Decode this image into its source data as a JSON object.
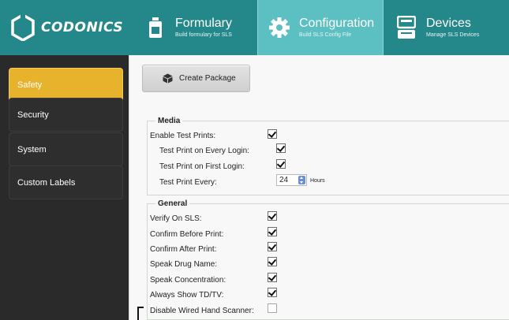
{
  "brand": {
    "name": "CODONICS"
  },
  "nav": {
    "tabs": [
      {
        "title": "Formulary",
        "subtitle": "Build formulary for SLS",
        "icon": "bottle-icon",
        "active": false
      },
      {
        "title": "Configuration",
        "subtitle": "Build SLS Config File",
        "icon": "gear-icon",
        "active": true
      },
      {
        "title": "Devices",
        "subtitle": "Manage SLS Devices",
        "icon": "printer-device-icon",
        "active": false
      }
    ]
  },
  "sidebar": {
    "items": [
      {
        "label": "Safety",
        "active": true
      },
      {
        "label": "Security",
        "active": false
      },
      {
        "label": "System",
        "active": false
      },
      {
        "label": "Custom Labels",
        "active": false
      }
    ]
  },
  "toolbar": {
    "create_package_label": "Create Package"
  },
  "media": {
    "legend": "Media",
    "enable_test_prints": {
      "label": "Enable Test Prints:",
      "checked": true
    },
    "test_print_every_login": {
      "label": "Test Print on Every Login:",
      "checked": true
    },
    "test_print_first_login": {
      "label": "Test Print on First Login:",
      "checked": true
    },
    "test_print_every": {
      "label": "Test Print Every:",
      "value": "24",
      "unit": "Hours"
    }
  },
  "general": {
    "legend": "General",
    "items": [
      {
        "label": "Verify On SLS:",
        "checked": true
      },
      {
        "label": "Confirm Before Print:",
        "checked": true
      },
      {
        "label": "Confirm After Print:",
        "checked": true
      },
      {
        "label": "Speak Drug Name:",
        "checked": true
      },
      {
        "label": "Speak Concentration:",
        "checked": true
      },
      {
        "label": "Always Show TD/TV:",
        "checked": true
      },
      {
        "label": "Disable Wired Hand Scanner:",
        "checked": false
      }
    ]
  },
  "colors": {
    "header": "#24888b",
    "active_tab": "#5cc0c2",
    "sidebar": "#2a2a2a",
    "active_item": "#e8b32c"
  }
}
